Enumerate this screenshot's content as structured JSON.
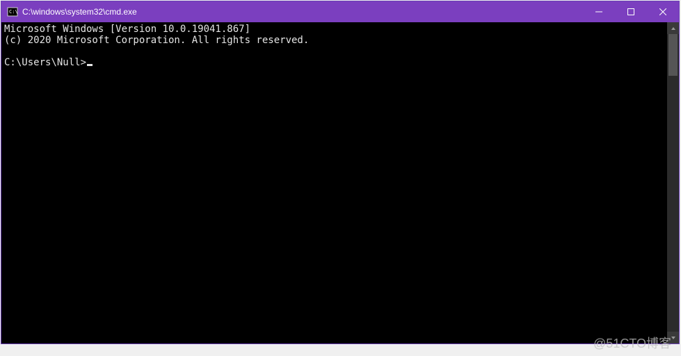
{
  "titlebar": {
    "title": "C:\\windows\\system32\\cmd.exe"
  },
  "terminal": {
    "line1": "Microsoft Windows [Version 10.0.19041.867]",
    "line2": "(c) 2020 Microsoft Corporation. All rights reserved.",
    "blank": "",
    "prompt": "C:\\Users\\Null>"
  },
  "watermark": "@51CTO博客"
}
